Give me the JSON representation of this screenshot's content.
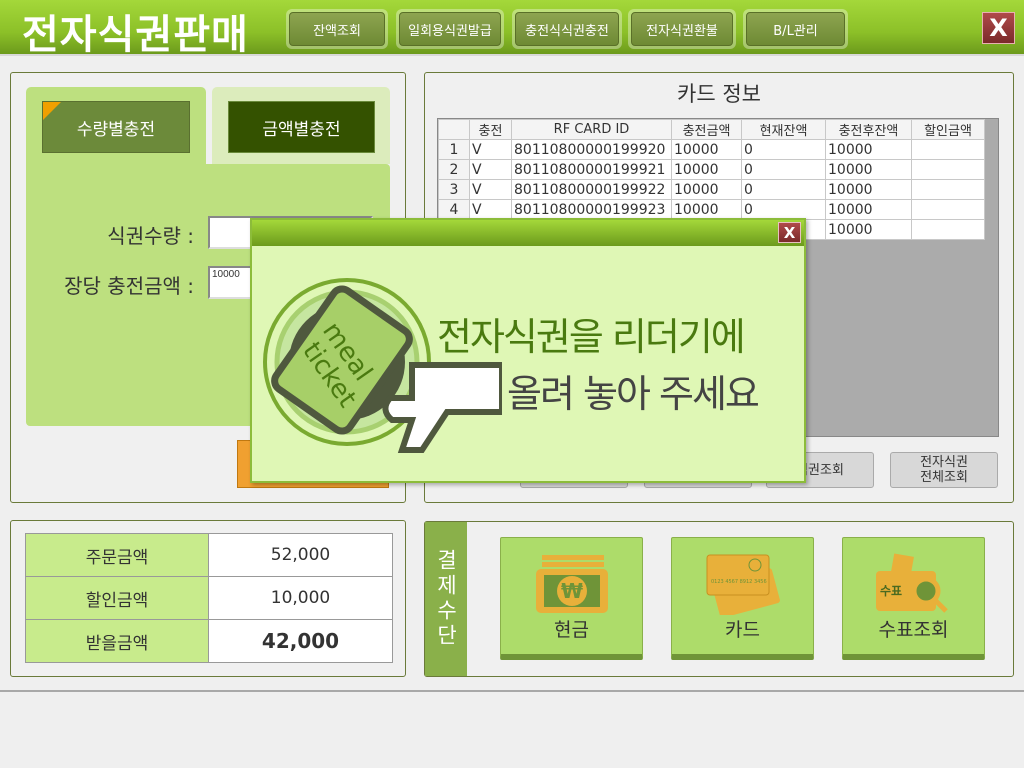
{
  "header": {
    "title": "전자식권판매",
    "nav": [
      "잔액조회",
      "일회용식권발급",
      "충전식식권충전",
      "전자식권환불",
      "B/L관리"
    ],
    "close": "X"
  },
  "charge": {
    "tabs": [
      "수량별충전",
      "금액별충전"
    ],
    "qty_label": "식권수량 :",
    "qty_value": "",
    "unit_label": "장당 충전금액 :",
    "unit_value": "10000"
  },
  "card_info": {
    "title": "카드 정보",
    "columns": [
      "",
      "충전",
      "RF CARD ID",
      "충전금액",
      "현재잔액",
      "충전후잔액",
      "할인금액"
    ],
    "rows": [
      [
        "1",
        "V",
        "80110800000199920",
        "10000",
        "0",
        "10000",
        ""
      ],
      [
        "2",
        "V",
        "80110800000199921",
        "10000",
        "0",
        "10000",
        ""
      ],
      [
        "3",
        "V",
        "80110800000199922",
        "10000",
        "0",
        "10000",
        ""
      ],
      [
        "4",
        "V",
        "80110800000199923",
        "10000",
        "0",
        "10000",
        ""
      ],
      [
        "",
        "",
        "",
        "",
        "",
        "10000",
        ""
      ]
    ],
    "buttons": [
      "",
      "",
      "식권조회",
      "전자식권\n전체조회"
    ]
  },
  "summary": {
    "rows": [
      {
        "label": "주문금액",
        "value": "52,000"
      },
      {
        "label": "할인금액",
        "value": "10,000"
      },
      {
        "label": "받을금액",
        "value": "42,000"
      }
    ]
  },
  "payment": {
    "label": "결제수단",
    "methods": [
      "현금",
      "카드",
      "수표조회"
    ]
  },
  "modal": {
    "close": "X",
    "line1a": "전자식권을",
    "line1b": "리더기에",
    "line2": "올려 놓아 주세요",
    "logo_text": "meal ticket"
  },
  "colors": {
    "accent": "#8cc028",
    "dark_green": "#3a5a00",
    "orange": "#f0a030"
  }
}
